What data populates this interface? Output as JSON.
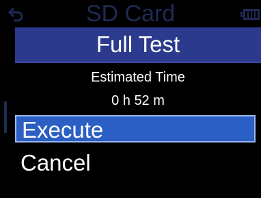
{
  "background": {
    "title": "SD Card",
    "back_icon": "back-arrow-icon",
    "battery_icon": "battery-icon"
  },
  "dialog": {
    "title": "Full Test",
    "estimated_label": "Estimated Time",
    "estimated_value": "0 h 52 m",
    "options": [
      "Execute",
      "Cancel"
    ],
    "selected": "Execute"
  },
  "colors": {
    "title_bar": "#2b3a8c",
    "selection": "#2c5fc4",
    "selection_border": "#9bb7ef",
    "dimmed_text": "#1f2a55"
  }
}
